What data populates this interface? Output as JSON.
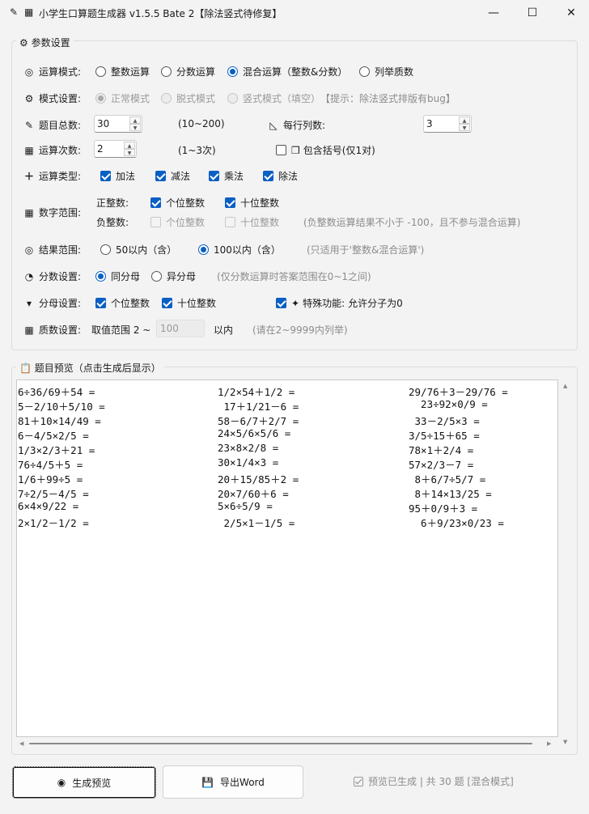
{
  "window": {
    "title": "小学生口算题生成器 v1.5.5 Bate 2【除法竖式待修复】",
    "minimize": "—",
    "maximize": "☐",
    "close": "✕"
  },
  "params": {
    "group_title": "参数设置",
    "mode": {
      "label": "运算模式:",
      "options": [
        "整数运算",
        "分数运算",
        "混合运算（整数&分数）",
        "列举质数"
      ],
      "selected": 2
    },
    "style": {
      "label": "模式设置:",
      "options": [
        "正常模式",
        "脱式模式",
        "竖式模式（填空）"
      ],
      "selected": 0,
      "hint": "【提示：除法竖式排版有bug】"
    },
    "total": {
      "label": "题目总数:",
      "value": "30",
      "range": "(10~200)"
    },
    "cols": {
      "label": "每行列数:",
      "value": "3"
    },
    "ops_count": {
      "label": "运算次数:",
      "value": "2",
      "range": "(1~3次)"
    },
    "brackets": {
      "label": "包含括号(仅1对)",
      "checked": false
    },
    "op_types": {
      "label": "运算类型:",
      "items": [
        {
          "label": "加法",
          "checked": true
        },
        {
          "label": "减法",
          "checked": true
        },
        {
          "label": "乘法",
          "checked": true
        },
        {
          "label": "除法",
          "checked": true
        }
      ]
    },
    "number_range": {
      "label": "数字范围:",
      "positive_label": "正整数:",
      "positive": [
        {
          "label": "个位整数",
          "checked": true
        },
        {
          "label": "十位整数",
          "checked": true
        }
      ],
      "negative_label": "负整数:",
      "negative": [
        {
          "label": "个位整数",
          "checked": false
        },
        {
          "label": "十位整数",
          "checked": false
        }
      ],
      "negative_hint": "(负整数运算结果不小于 -100，且不参与混合运算)"
    },
    "result_range": {
      "label": "结果范围:",
      "options": [
        "50以内（含）",
        "100以内（含）"
      ],
      "selected": 1,
      "hint": "(只适用于'整数&混合运算')"
    },
    "fraction": {
      "label": "分数设置:",
      "options": [
        "同分母",
        "异分母"
      ],
      "selected": 0,
      "hint": "(仅分数运算时答案范围在0~1之间)"
    },
    "denominator": {
      "label": "分母设置:",
      "items": [
        {
          "label": "个位整数",
          "checked": true
        },
        {
          "label": "十位整数",
          "checked": true
        }
      ],
      "special_checked": true,
      "special_label": "特殊功能:",
      "special_text": "允许分子为0"
    },
    "prime": {
      "label": "质数设置:",
      "prefix": "取值范围 2 ~",
      "value": "100",
      "suffix": "以内",
      "hint": "(请在2~9999内列举)"
    }
  },
  "preview": {
    "group_title": "题目预览（点击生成后显示）",
    "rows": [
      [
        "6÷36/69＋54 =",
        "1/2×54＋1/2 =",
        "29/76＋3－29/76 ="
      ],
      [
        "5－2/10＋5/10 =",
        " 17＋1/21－6 =",
        "  23÷92×0/9 ="
      ],
      [
        "81＋10×14/49 =",
        "58－6/7＋2/7 =",
        " 33－2/5×3 ="
      ],
      [
        "6－4/5×2/5 =",
        "24×5/6×5/6 =",
        "3/5÷15＋65 ="
      ],
      [
        "1/3×2/3＋21 =",
        "23×8×2/8 =",
        "78×1＋2/4 ="
      ],
      [
        "76÷4/5＋5 =",
        "30×1/4×3 =",
        "57×2/3－7 ="
      ],
      [
        "1/6＋99÷5 =",
        "20＋15/85＋2 =",
        " 8＋6/7÷5/7 ="
      ],
      [
        "7÷2/5－4/5 =",
        "20×7/60＋6 =",
        " 8＋14×13/25 ="
      ],
      [
        "6×4×9/22 =",
        "5×6÷5/9 =",
        "95＋0/9＋3 ="
      ],
      [
        "2×1/2－1/2 =",
        " 2/5×1－1/5 =",
        "  6＋9/23×0/23 ="
      ]
    ]
  },
  "buttons": {
    "preview": "生成预览",
    "export": "导出Word"
  },
  "status": "预览已生成 | 共 30 题 [混合模式]"
}
